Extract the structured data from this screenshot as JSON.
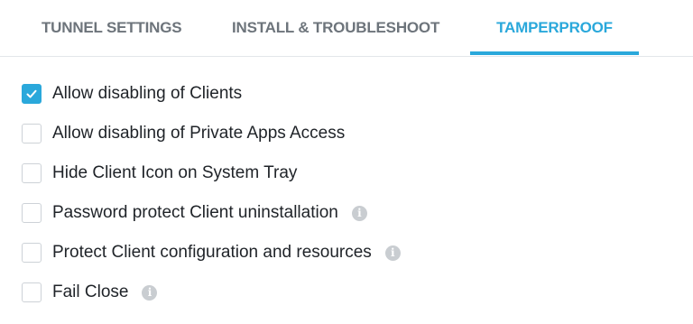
{
  "tabs": [
    {
      "label": "TUNNEL SETTINGS",
      "active": false
    },
    {
      "label": "INSTALL & TROUBLESHOOT",
      "active": false
    },
    {
      "label": "TAMPERPROOF",
      "active": true
    }
  ],
  "colors": {
    "accent": "#2aa8db",
    "tab_inactive": "#6d747b",
    "text": "#1f2328"
  },
  "options": [
    {
      "label": "Allow disabling of Clients",
      "checked": true,
      "has_info": false
    },
    {
      "label": "Allow disabling of Private Apps Access",
      "checked": false,
      "has_info": false
    },
    {
      "label": "Hide Client Icon on System Tray",
      "checked": false,
      "has_info": false
    },
    {
      "label": "Password protect Client uninstallation",
      "checked": false,
      "has_info": true
    },
    {
      "label": "Protect Client configuration and resources",
      "checked": false,
      "has_info": true
    },
    {
      "label": "Fail Close",
      "checked": false,
      "has_info": true
    }
  ],
  "icons": {
    "checkmark": "checkmark-icon",
    "info": "info-icon"
  }
}
